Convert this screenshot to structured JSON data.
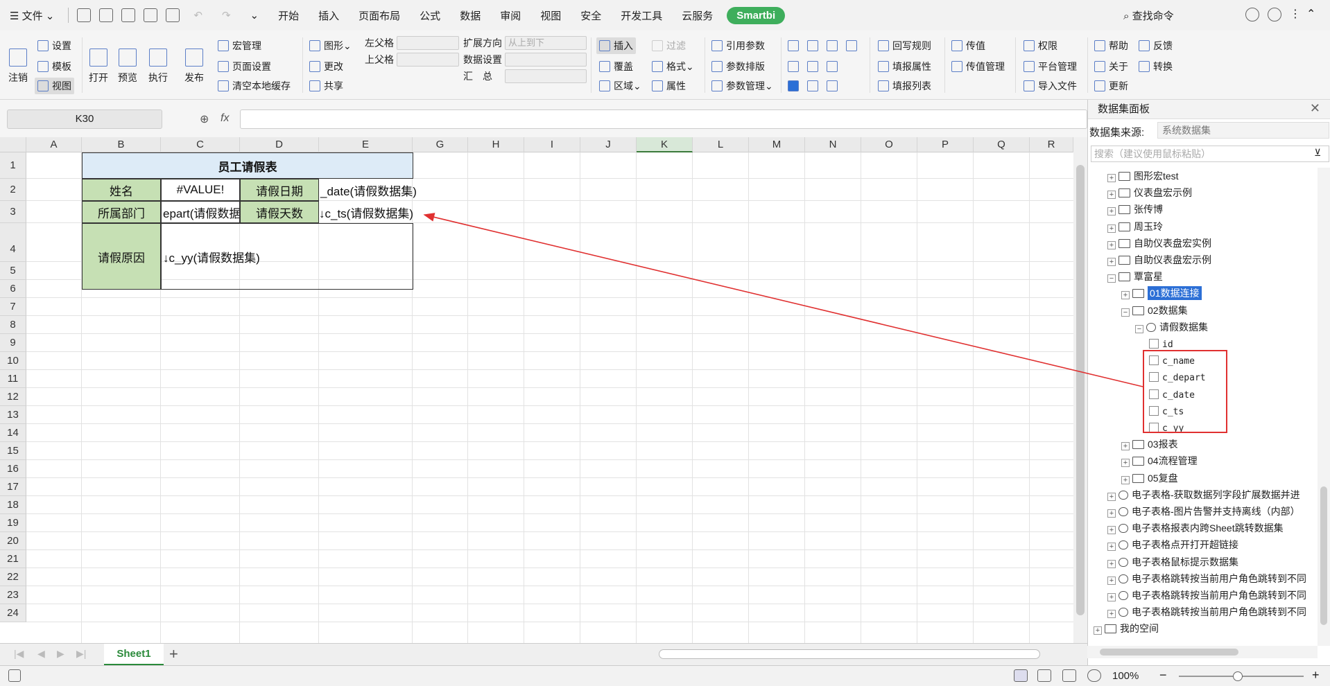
{
  "menubar": {
    "file_label": "文件",
    "tabs": [
      "开始",
      "插入",
      "页面布局",
      "公式",
      "数据",
      "审阅",
      "视图",
      "安全",
      "开发工具",
      "云服务"
    ],
    "smartbi_label": "Smartbi",
    "find_command": "查找命令"
  },
  "ribbon": {
    "logout": "注销",
    "settings": "设置",
    "template": "模板",
    "view": "视图",
    "open": "打开",
    "preview": "预览",
    "execute": "执行",
    "publish": "发布",
    "macro_manage": "宏管理",
    "page_setup": "页面设置",
    "clear_cache": "清空本地缓存",
    "chart": "图形",
    "change": "更改",
    "share": "共享",
    "left_parent": "左父格",
    "up_parent": "上父格",
    "expand_direction": "扩展方向",
    "expand_direction_value": "从上到下",
    "data_settings": "数据设置",
    "summary": "汇　总",
    "insert": "插入",
    "filter": "过滤",
    "overwrite": "覆盖",
    "format": "格式",
    "region": "区域",
    "property": "属性",
    "ref_param": "引用参数",
    "param_layout": "参数排版",
    "param_manage": "参数管理",
    "writeback_rule": "回写规则",
    "fill_property": "填报属性",
    "fill_list": "填报列表",
    "pass_value": "传值",
    "pass_value_manage": "传值管理",
    "permission": "权限",
    "platform_manage": "平台管理",
    "import_file": "导入文件",
    "help": "帮助",
    "feedback": "反馈",
    "about": "关于",
    "convert": "转换",
    "update": "更新"
  },
  "formula_bar": {
    "name_box": "K30",
    "fx": "fx",
    "value": ""
  },
  "sheet": {
    "columns": [
      "A",
      "B",
      "C",
      "D",
      "E",
      "G",
      "H",
      "I",
      "J",
      "K",
      "L",
      "M",
      "N",
      "O",
      "P",
      "Q",
      "R"
    ],
    "rows": [
      "1",
      "2",
      "3",
      "4",
      "5",
      "6",
      "7",
      "8",
      "9",
      "10",
      "11",
      "12",
      "13",
      "14",
      "15",
      "16",
      "17",
      "18",
      "19",
      "20",
      "21",
      "22",
      "23",
      "24"
    ],
    "title": "员工请假表",
    "name_label": "姓名",
    "name_value": "#VALUE!",
    "date_label": "请假日期",
    "date_value": "_date(请假数据集)",
    "dept_label": "所属部门",
    "dept_value": "epart(请假数据",
    "days_label": "请假天数",
    "days_value": "↓c_ts(请假数据集)",
    "reason_label": "请假原因",
    "reason_value": "↓c_yy(请假数据集)"
  },
  "sheet_tabs": {
    "active": "Sheet1",
    "add": "+"
  },
  "statusbar": {
    "zoom": "100%"
  },
  "panel": {
    "title": "数据集面板",
    "source_label": "数据集来源:",
    "source_value": "系统数据集",
    "search_placeholder": "搜索（建议使用鼠标粘贴）",
    "tree": [
      {
        "label": "图形宏test"
      },
      {
        "label": "仪表盘宏示例"
      },
      {
        "label": "张传博"
      },
      {
        "label": "周玉玲"
      },
      {
        "label": "自助仪表盘宏实例"
      },
      {
        "label": "自助仪表盘宏示例"
      },
      {
        "label": "覃富星"
      },
      {
        "label": "01数据连接"
      },
      {
        "label": "02数据集"
      },
      {
        "label": "请假数据集"
      },
      {
        "label": "id"
      },
      {
        "label": "c_name"
      },
      {
        "label": "c_depart"
      },
      {
        "label": "c_date"
      },
      {
        "label": "c_ts"
      },
      {
        "label": "c_yy"
      },
      {
        "label": "03报表"
      },
      {
        "label": "04流程管理"
      },
      {
        "label": "05复盘"
      },
      {
        "label": "电子表格-获取数据列字段扩展数据并进"
      },
      {
        "label": "电子表格-图片告警并支持离线（内部）"
      },
      {
        "label": "电子表格报表内跨Sheet跳转数据集"
      },
      {
        "label": "电子表格点开打开超链接"
      },
      {
        "label": "电子表格鼠标提示数据集"
      },
      {
        "label": "电子表格跳转按当前用户角色跳转到不同"
      },
      {
        "label": "电子表格跳转按当前用户角色跳转到不同"
      },
      {
        "label": "电子表格跳转按当前用户角色跳转到不同"
      },
      {
        "label": "我的空间"
      }
    ]
  },
  "colors": {
    "accent_green": "#3eae5c",
    "label_fill": "#c6e0b4",
    "title_fill": "#ddebf7",
    "annotation_red": "#e03030",
    "selection_blue": "#2c6fd6"
  }
}
